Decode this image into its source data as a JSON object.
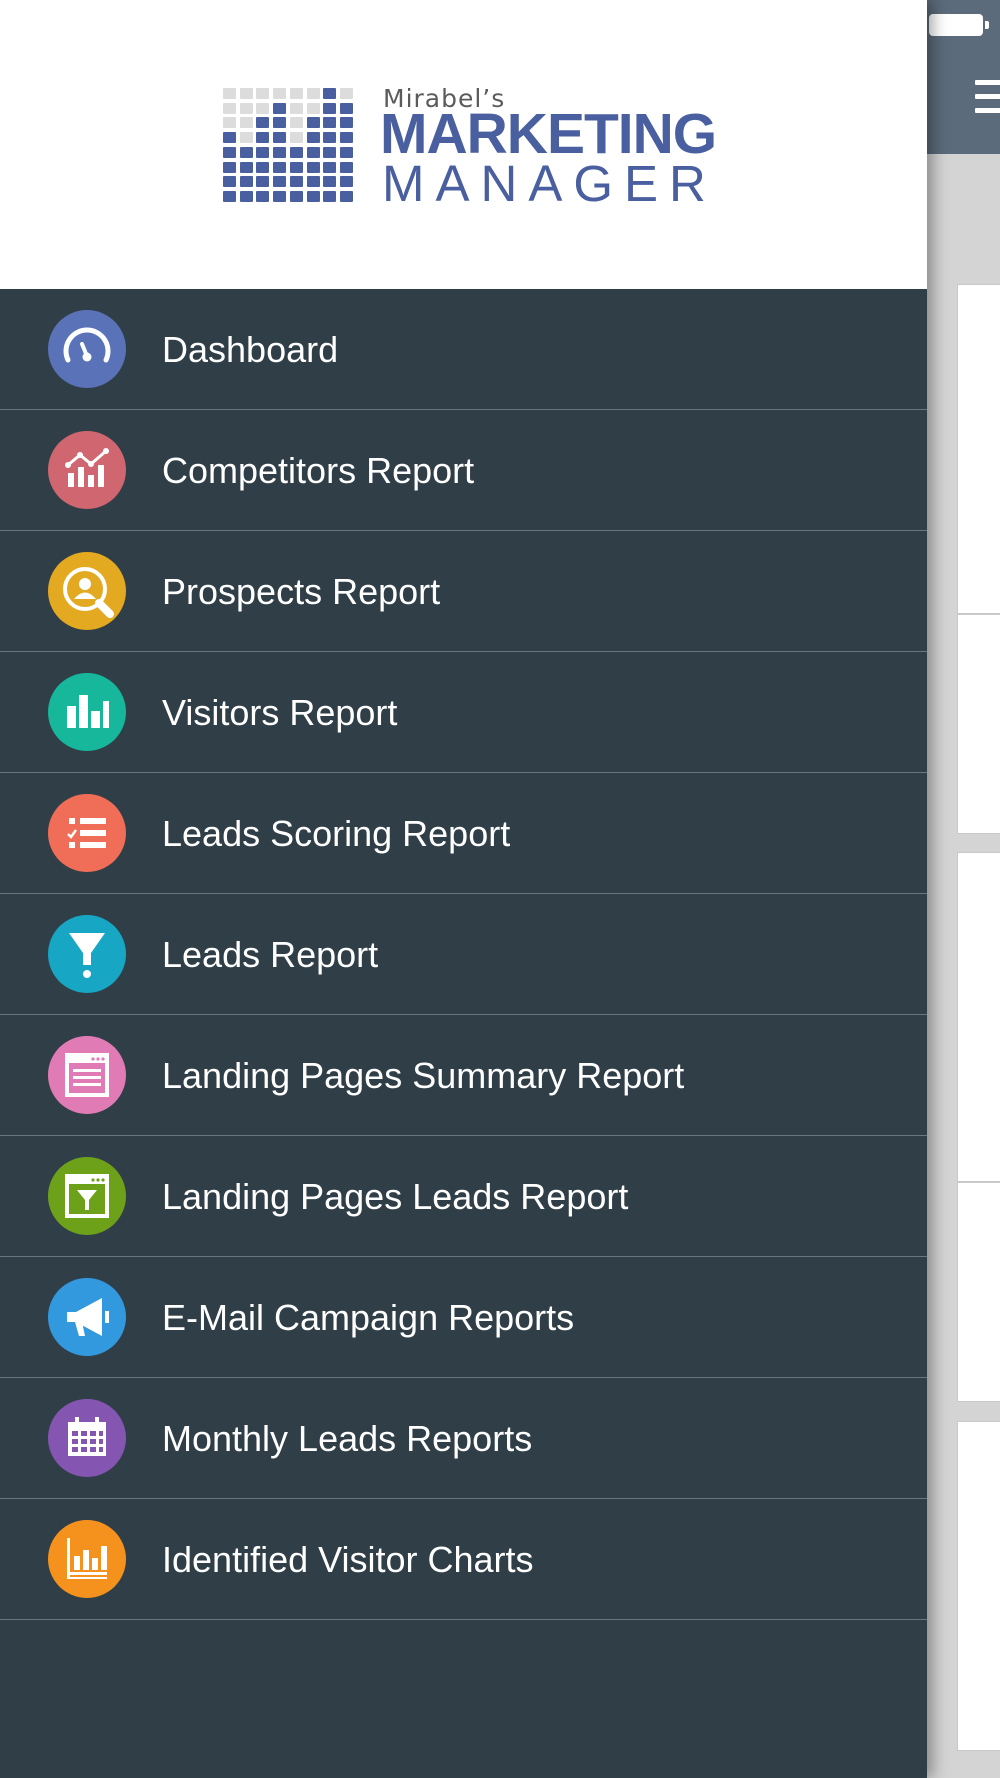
{
  "brand": {
    "eyebrow": "Mirabel’s",
    "line1": "MARKETING",
    "line2": "MANAGER",
    "color": "#4a5fa0"
  },
  "drawer": {
    "background": "#303e47"
  },
  "menu": {
    "items": [
      {
        "label": "Dashboard",
        "icon": "speedometer-icon",
        "color": "#5a72b8"
      },
      {
        "label": "Competitors Report",
        "icon": "chart-trend-icon",
        "color": "#cf6670"
      },
      {
        "label": "Prospects Report",
        "icon": "person-search-icon",
        "color": "#e3a921"
      },
      {
        "label": "Visitors Report",
        "icon": "bar-chart-icon",
        "color": "#16b79a"
      },
      {
        "label": "Leads Scoring Report",
        "icon": "checklist-icon",
        "color": "#f06e57"
      },
      {
        "label": "Leads Report",
        "icon": "funnel-icon",
        "color": "#17a6c4"
      },
      {
        "label": "Landing Pages Summary Report",
        "icon": "browser-list-icon",
        "color": "#e07bb5"
      },
      {
        "label": "Landing Pages Leads Report",
        "icon": "browser-funnel-icon",
        "color": "#6ea11a"
      },
      {
        "label": "E-Mail Campaign Reports",
        "icon": "megaphone-icon",
        "color": "#3399de"
      },
      {
        "label": "Monthly Leads Reports",
        "icon": "calendar-icon",
        "color": "#8456b1"
      },
      {
        "label": "Identified Visitor Charts",
        "icon": "column-chart-icon",
        "color": "#f5921e"
      }
    ]
  },
  "main": {
    "header_color": "#5b6b7b"
  }
}
